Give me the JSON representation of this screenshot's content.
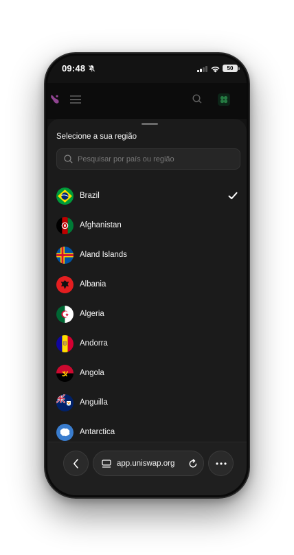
{
  "status_bar": {
    "time": "09:48",
    "battery": "50"
  },
  "sheet": {
    "title": "Selecione a sua região",
    "search_placeholder": "Pesquisar por país ou região"
  },
  "countries": [
    {
      "name": "Brazil",
      "selected": true
    },
    {
      "name": "Afghanistan",
      "selected": false
    },
    {
      "name": "Aland Islands",
      "selected": false
    },
    {
      "name": "Albania",
      "selected": false
    },
    {
      "name": "Algeria",
      "selected": false
    },
    {
      "name": "Andorra",
      "selected": false
    },
    {
      "name": "Angola",
      "selected": false
    },
    {
      "name": "Anguilla",
      "selected": false
    },
    {
      "name": "Antarctica",
      "selected": false
    }
  ],
  "browser": {
    "url": "app.uniswap.org"
  },
  "colors": {
    "sheet_background": "#1b1b1b",
    "accent_logo": "#fc72ff",
    "text": "#f2f2f2"
  }
}
